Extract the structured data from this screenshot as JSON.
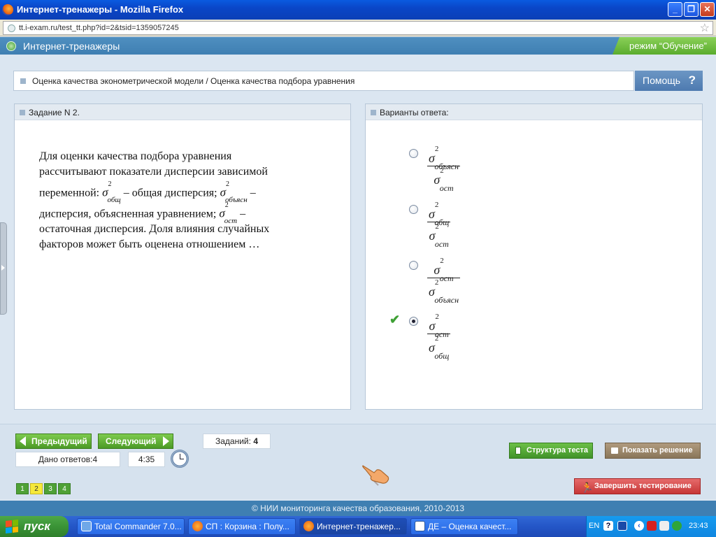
{
  "window": {
    "title": "Интернет-тренажеры - Mozilla Firefox",
    "url": "tt.i-exam.ru/test_tt.php?id=2&tsid=1359057245",
    "minimize": "_",
    "maximize": "❐",
    "close": "✕"
  },
  "header": {
    "app_title": "Интернет-тренажеры",
    "mode": "режим “Обучение”"
  },
  "breadcrumb": {
    "text": "Оценка качества эконометрической модели / Оценка качества подбора уравнения",
    "help_label": "Помощь",
    "help_icon": "?"
  },
  "task": {
    "title": "Задание N 2.",
    "lines": {
      "l1": "Для оценки качества подбора уравнения",
      "l2": "рассчитывают показатели дисперсии зависимой",
      "l3a": "переменной:",
      "l3b": "– общая дисперсия;",
      "l3c": "–",
      "l4a": "дисперсия, объясненная уравнением;",
      "l4b": "–",
      "l5": "остаточная дисперсия. Доля влияния случайных",
      "l6": "факторов может быть оценена отношением …"
    },
    "sym": {
      "sigma": "σ",
      "sq": "2",
      "obsh": "общ",
      "obyasn": "объясн",
      "ost": "ост"
    }
  },
  "answers": {
    "title": "Варианты ответа:",
    "selected_index": 4,
    "options": [
      {
        "num_sub": "объясн",
        "den_sub": "ост"
      },
      {
        "num_sub": "общ",
        "den_sub": "ост"
      },
      {
        "num_sub": "ост",
        "den_sub": "объясн"
      },
      {
        "num_sub": "ост",
        "den_sub": "общ"
      }
    ]
  },
  "nav": {
    "prev_label": "Предыдущий",
    "next_label": "Следующий",
    "tasks_label": "Заданий:",
    "tasks_count": "4",
    "answered": "Дано ответов:4",
    "timer": "4:35",
    "pages": [
      "1",
      "2",
      "3",
      "4"
    ],
    "current_page": "2"
  },
  "actions": {
    "structure": "Структура теста",
    "solution": "Показать решение",
    "finish": "Завершить тестирование"
  },
  "footer": {
    "text": "© НИИ мониторинга качества образования, 2010-2013"
  },
  "taskbar": {
    "start": "пуск",
    "items": [
      "Total Commander 7.0...",
      "СП : Корзина : Полу...",
      "Интернет-тренажер...",
      "ДЕ – Оценка качест..."
    ],
    "lang": "EN",
    "time": "23:43"
  },
  "colors": {
    "header_blue": "#3f7fb2",
    "mode_green": "#6bbb3c",
    "nav_green": "#4b9a25",
    "finish_red": "#c63636",
    "solution_brown": "#8a765a",
    "current_page_yellow": "#f6e93a"
  }
}
